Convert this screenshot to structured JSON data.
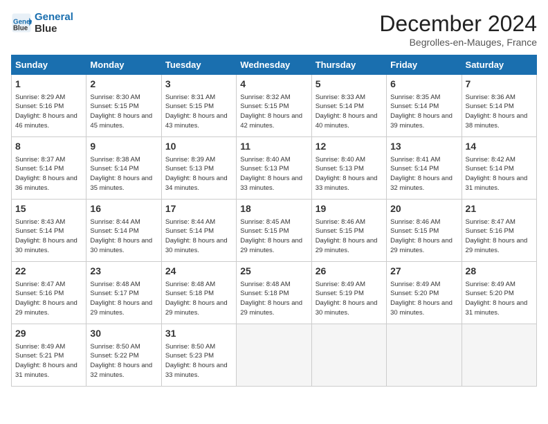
{
  "header": {
    "logo_line1": "General",
    "logo_line2": "Blue",
    "month": "December 2024",
    "location": "Begrolles-en-Mauges, France"
  },
  "days_of_week": [
    "Sunday",
    "Monday",
    "Tuesday",
    "Wednesday",
    "Thursday",
    "Friday",
    "Saturday"
  ],
  "weeks": [
    [
      {
        "day": "1",
        "sunrise": "8:29 AM",
        "sunset": "5:16 PM",
        "daylight": "8 hours and 46 minutes."
      },
      {
        "day": "2",
        "sunrise": "8:30 AM",
        "sunset": "5:15 PM",
        "daylight": "8 hours and 45 minutes."
      },
      {
        "day": "3",
        "sunrise": "8:31 AM",
        "sunset": "5:15 PM",
        "daylight": "8 hours and 43 minutes."
      },
      {
        "day": "4",
        "sunrise": "8:32 AM",
        "sunset": "5:15 PM",
        "daylight": "8 hours and 42 minutes."
      },
      {
        "day": "5",
        "sunrise": "8:33 AM",
        "sunset": "5:14 PM",
        "daylight": "8 hours and 40 minutes."
      },
      {
        "day": "6",
        "sunrise": "8:35 AM",
        "sunset": "5:14 PM",
        "daylight": "8 hours and 39 minutes."
      },
      {
        "day": "7",
        "sunrise": "8:36 AM",
        "sunset": "5:14 PM",
        "daylight": "8 hours and 38 minutes."
      }
    ],
    [
      {
        "day": "8",
        "sunrise": "8:37 AM",
        "sunset": "5:14 PM",
        "daylight": "8 hours and 36 minutes."
      },
      {
        "day": "9",
        "sunrise": "8:38 AM",
        "sunset": "5:14 PM",
        "daylight": "8 hours and 35 minutes."
      },
      {
        "day": "10",
        "sunrise": "8:39 AM",
        "sunset": "5:13 PM",
        "daylight": "8 hours and 34 minutes."
      },
      {
        "day": "11",
        "sunrise": "8:40 AM",
        "sunset": "5:13 PM",
        "daylight": "8 hours and 33 minutes."
      },
      {
        "day": "12",
        "sunrise": "8:40 AM",
        "sunset": "5:13 PM",
        "daylight": "8 hours and 33 minutes."
      },
      {
        "day": "13",
        "sunrise": "8:41 AM",
        "sunset": "5:14 PM",
        "daylight": "8 hours and 32 minutes."
      },
      {
        "day": "14",
        "sunrise": "8:42 AM",
        "sunset": "5:14 PM",
        "daylight": "8 hours and 31 minutes."
      }
    ],
    [
      {
        "day": "15",
        "sunrise": "8:43 AM",
        "sunset": "5:14 PM",
        "daylight": "8 hours and 30 minutes."
      },
      {
        "day": "16",
        "sunrise": "8:44 AM",
        "sunset": "5:14 PM",
        "daylight": "8 hours and 30 minutes."
      },
      {
        "day": "17",
        "sunrise": "8:44 AM",
        "sunset": "5:14 PM",
        "daylight": "8 hours and 30 minutes."
      },
      {
        "day": "18",
        "sunrise": "8:45 AM",
        "sunset": "5:15 PM",
        "daylight": "8 hours and 29 minutes."
      },
      {
        "day": "19",
        "sunrise": "8:46 AM",
        "sunset": "5:15 PM",
        "daylight": "8 hours and 29 minutes."
      },
      {
        "day": "20",
        "sunrise": "8:46 AM",
        "sunset": "5:15 PM",
        "daylight": "8 hours and 29 minutes."
      },
      {
        "day": "21",
        "sunrise": "8:47 AM",
        "sunset": "5:16 PM",
        "daylight": "8 hours and 29 minutes."
      }
    ],
    [
      {
        "day": "22",
        "sunrise": "8:47 AM",
        "sunset": "5:16 PM",
        "daylight": "8 hours and 29 minutes."
      },
      {
        "day": "23",
        "sunrise": "8:48 AM",
        "sunset": "5:17 PM",
        "daylight": "8 hours and 29 minutes."
      },
      {
        "day": "24",
        "sunrise": "8:48 AM",
        "sunset": "5:18 PM",
        "daylight": "8 hours and 29 minutes."
      },
      {
        "day": "25",
        "sunrise": "8:48 AM",
        "sunset": "5:18 PM",
        "daylight": "8 hours and 29 minutes."
      },
      {
        "day": "26",
        "sunrise": "8:49 AM",
        "sunset": "5:19 PM",
        "daylight": "8 hours and 30 minutes."
      },
      {
        "day": "27",
        "sunrise": "8:49 AM",
        "sunset": "5:20 PM",
        "daylight": "8 hours and 30 minutes."
      },
      {
        "day": "28",
        "sunrise": "8:49 AM",
        "sunset": "5:20 PM",
        "daylight": "8 hours and 31 minutes."
      }
    ],
    [
      {
        "day": "29",
        "sunrise": "8:49 AM",
        "sunset": "5:21 PM",
        "daylight": "8 hours and 31 minutes."
      },
      {
        "day": "30",
        "sunrise": "8:50 AM",
        "sunset": "5:22 PM",
        "daylight": "8 hours and 32 minutes."
      },
      {
        "day": "31",
        "sunrise": "8:50 AM",
        "sunset": "5:23 PM",
        "daylight": "8 hours and 33 minutes."
      },
      null,
      null,
      null,
      null
    ]
  ]
}
